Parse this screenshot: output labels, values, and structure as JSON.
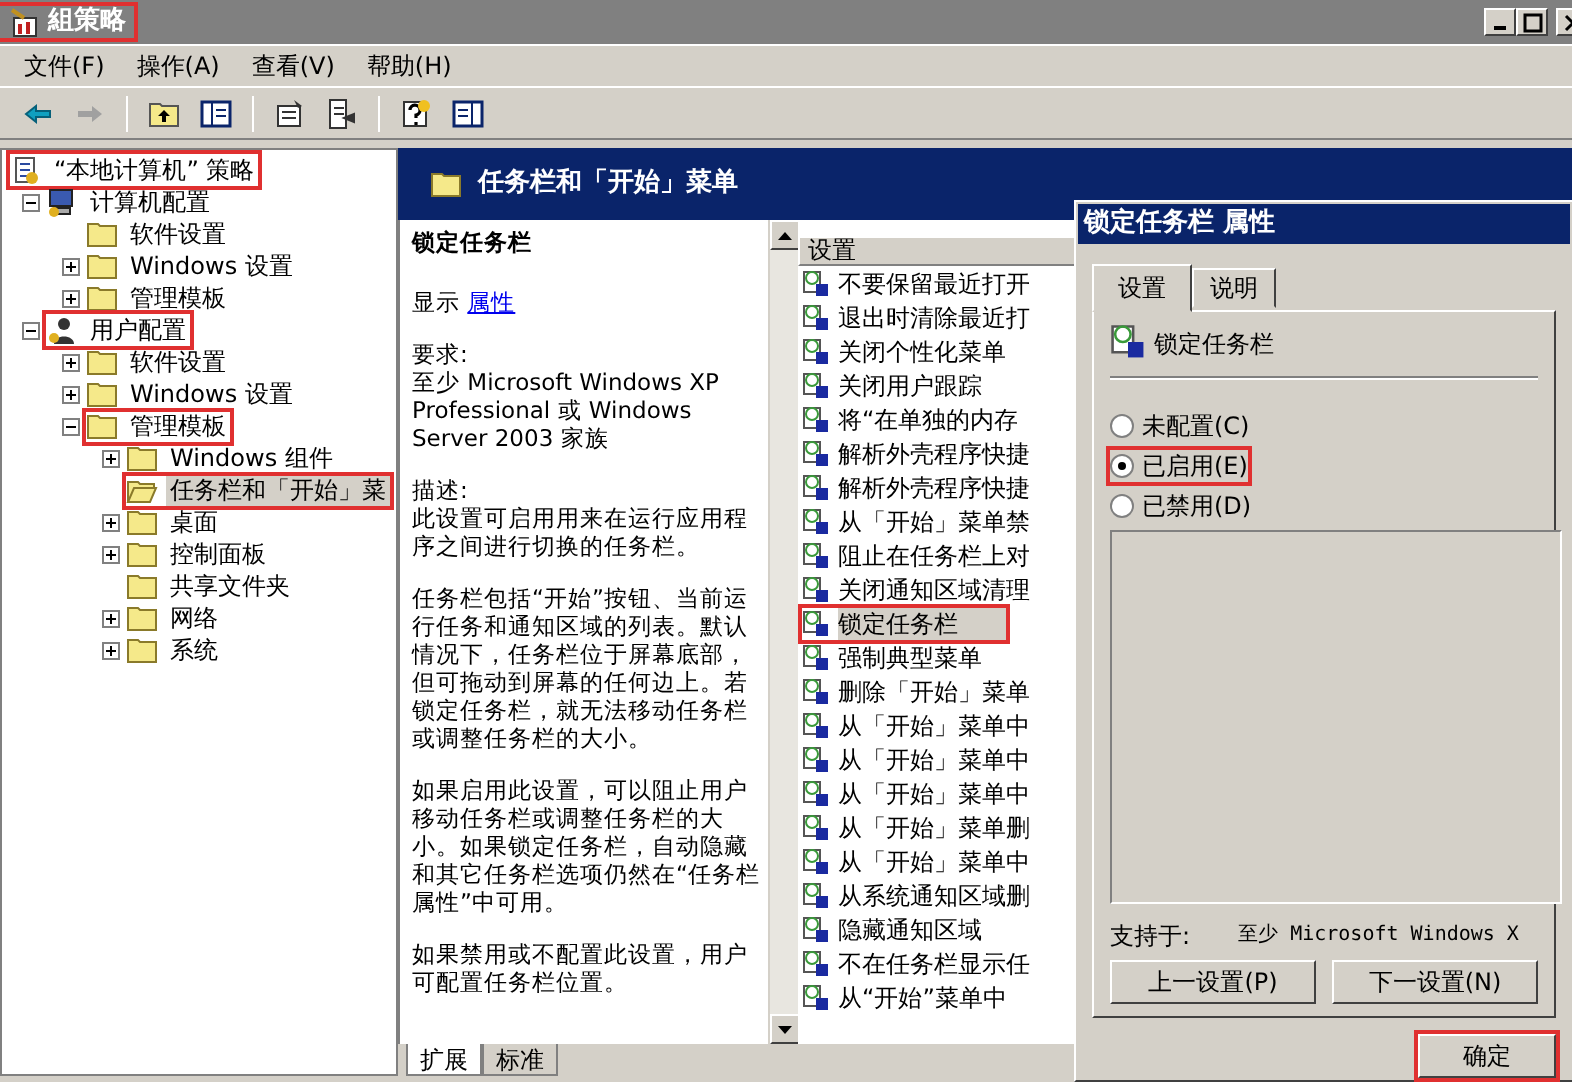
{
  "window": {
    "title": "組策略",
    "highlighted": true
  },
  "menu": [
    "文件(F)",
    "操作(A)",
    "查看(V)",
    "帮助(H)"
  ],
  "tree": {
    "label": "“本地计算机” 策略",
    "kind": "root",
    "highlighted": true,
    "selected": false,
    "children": [
      {
        "label": "计算机配置",
        "kind": "computer",
        "expanded": true,
        "highlighted": false,
        "selected": false,
        "children": [
          {
            "label": "软件设置",
            "kind": "folder",
            "highlighted": false,
            "selected": false
          },
          {
            "label": "Windows 设置",
            "kind": "folder",
            "expanded": false,
            "highlighted": false,
            "selected": false
          },
          {
            "label": "管理模板",
            "kind": "folder",
            "expanded": false,
            "highlighted": false,
            "selected": false
          }
        ]
      },
      {
        "label": "用户配置",
        "kind": "user",
        "expanded": true,
        "highlighted": true,
        "selected": false,
        "children": [
          {
            "label": "软件设置",
            "kind": "folder",
            "expanded": false,
            "highlighted": false,
            "selected": false
          },
          {
            "label": "Windows 设置",
            "kind": "folder",
            "expanded": false,
            "highlighted": false,
            "selected": false
          },
          {
            "label": "管理模板",
            "kind": "folder",
            "expanded": true,
            "highlighted": true,
            "selected": false,
            "children": [
              {
                "label": "Windows 组件",
                "kind": "folder",
                "expanded": false,
                "highlighted": false,
                "selected": false
              },
              {
                "label": "任务栏和「开始」菜",
                "kind": "folder",
                "highlighted": true,
                "selected": true
              },
              {
                "label": "桌面",
                "kind": "folder",
                "expanded": false,
                "highlighted": false,
                "selected": false
              },
              {
                "label": "控制面板",
                "kind": "folder",
                "expanded": false,
                "highlighted": false,
                "selected": false
              },
              {
                "label": "共享文件夹",
                "kind": "folder",
                "highlighted": false,
                "selected": false
              },
              {
                "label": "网络",
                "kind": "folder",
                "expanded": false,
                "highlighted": false,
                "selected": false
              },
              {
                "label": "系统",
                "kind": "folder",
                "expanded": false,
                "highlighted": false,
                "selected": false
              }
            ]
          }
        ]
      }
    ]
  },
  "details": {
    "header": "任务栏和「开始」菜单",
    "title": "锁定任务栏",
    "display_label": "显示",
    "display_link": "属性",
    "blocks": [
      {
        "lines": [
          "要求:",
          "至少 Microsoft Windows XP Professional 或 Windows Server 2003 家族"
        ]
      },
      {
        "lines": [
          "描述:",
          "此设置可启用用来在运行应用程序之间进行切换的任务栏。"
        ]
      },
      {
        "lines": [
          "任务栏包括“开始”按钮、当前运行任务和通知区域的列表。默认情况下，任务栏位于屏幕底部，但可拖动到屏幕的任何边上。若锁定任务栏，就无法移动任务栏或调整任务栏的大小。"
        ]
      },
      {
        "lines": [
          "如果启用此设置，可以阻止用户移动任务栏或调整任务栏的大小。如果锁定任务栏，自动隐藏和其它任务栏选项仍然在“任务栏属性”中可用。"
        ]
      },
      {
        "lines": [
          "如果禁用或不配置此设置，用户可配置任务栏位置。"
        ]
      }
    ]
  },
  "view_tabs": [
    {
      "label": "扩展",
      "selected": true
    },
    {
      "label": "标准",
      "selected": false
    }
  ],
  "settings_list": {
    "column": "设置",
    "items": [
      {
        "label": "不要保留最近打开",
        "selected": false,
        "highlighted": false
      },
      {
        "label": "退出时清除最近打",
        "selected": false,
        "highlighted": false
      },
      {
        "label": "关闭个性化菜单",
        "selected": false,
        "highlighted": false
      },
      {
        "label": "关闭用户跟踪",
        "selected": false,
        "highlighted": false
      },
      {
        "label": "将“在单独的内存",
        "selected": false,
        "highlighted": false
      },
      {
        "label": "解析外壳程序快捷",
        "selected": false,
        "highlighted": false
      },
      {
        "label": "解析外壳程序快捷",
        "selected": false,
        "highlighted": false
      },
      {
        "label": "从「开始」菜单禁",
        "selected": false,
        "highlighted": false
      },
      {
        "label": "阻止在任务栏上对",
        "selected": false,
        "highlighted": false
      },
      {
        "label": "关闭通知区域清理",
        "selected": false,
        "highlighted": false
      },
      {
        "label": "锁定任务栏",
        "selected": true,
        "highlighted": true
      },
      {
        "label": "强制典型菜单",
        "selected": false,
        "highlighted": false
      },
      {
        "label": "删除「开始」菜单",
        "selected": false,
        "highlighted": false
      },
      {
        "label": "从「开始」菜单中",
        "selected": false,
        "highlighted": false
      },
      {
        "label": "从「开始」菜单中",
        "selected": false,
        "highlighted": false
      },
      {
        "label": "从「开始」菜单中",
        "selected": false,
        "highlighted": false
      },
      {
        "label": "从「开始」菜单删",
        "selected": false,
        "highlighted": false
      },
      {
        "label": "从「开始」菜单中",
        "selected": false,
        "highlighted": false
      },
      {
        "label": "从系统通知区域删",
        "selected": false,
        "highlighted": false
      },
      {
        "label": "隐藏通知区域",
        "selected": false,
        "highlighted": false
      },
      {
        "label": "不在任务栏显示任",
        "selected": false,
        "highlighted": false
      },
      {
        "label": "从“开始”菜单中",
        "selected": false,
        "highlighted": false
      }
    ]
  },
  "dialog": {
    "title": "锁定任务栏 属性",
    "tabs": [
      {
        "label": "设置",
        "selected": true
      },
      {
        "label": "说明",
        "selected": false
      }
    ],
    "setting_name": "锁定任务栏",
    "options": [
      {
        "label": "未配置(C)",
        "selected": false,
        "highlighted": false
      },
      {
        "label": "已启用(E)",
        "selected": true,
        "highlighted": true
      },
      {
        "label": "已禁用(D)",
        "selected": false,
        "highlighted": false
      }
    ],
    "supported_label": "支持于:",
    "supported_value": "至少 Microsoft Windows X",
    "buttons": [
      {
        "label": "上一设置(P)",
        "highlighted": false
      },
      {
        "label": "下一设置(N)",
        "highlighted": false
      }
    ],
    "ok_button": {
      "label": "确定",
      "highlighted": true
    }
  }
}
